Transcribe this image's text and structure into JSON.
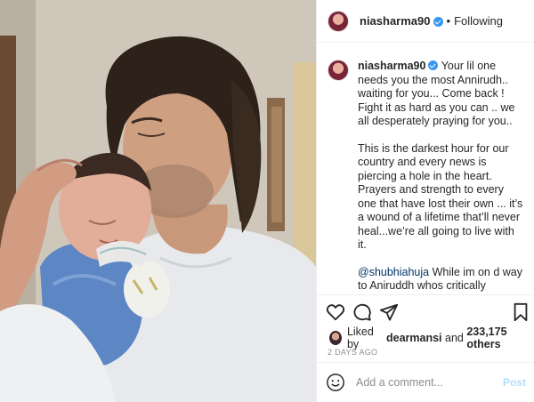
{
  "post": {
    "username": "niasharma90",
    "follow_separator": "•",
    "follow_status": "Following"
  },
  "caption": {
    "username": "niasharma90",
    "para1": "Your lil one needs you the most Annirudh.. waiting for you... Come back ! Fight it as hard as you can .. we all desperately praying for you..",
    "para2": "This is the darkest hour for our country and every news is piercing a hole in the heart. Prayers and strength to every one that have lost their own ... it’s a wound of a lifetime that’ll never heal...we’re all going to live with it.",
    "mention": "@shubhiahuja",
    "para3": " While im on d way to Aniruddh whos critically suffering at d moment .. i had to leave back home my 2 month old Anishq and this definitely a biggest challenge i have faced as he on one side he is"
  },
  "likes": {
    "prefix": "Liked by",
    "user": "dearmansi",
    "and": "and",
    "count": "233,175 others"
  },
  "date": "2 DAYS AGO",
  "comment_box": {
    "placeholder": "Add a comment...",
    "post_label": "Post"
  },
  "icons": {
    "like": "heart-icon",
    "comment": "comment-icon",
    "share": "paper-plane-icon",
    "save": "bookmark-icon",
    "emoji": "smiley-icon",
    "verified": "verified-badge-icon"
  },
  "colors": {
    "verified": "#3897f0",
    "post_button": "#b2dffc",
    "mention": "#003569",
    "muted": "#8e8e8e"
  }
}
